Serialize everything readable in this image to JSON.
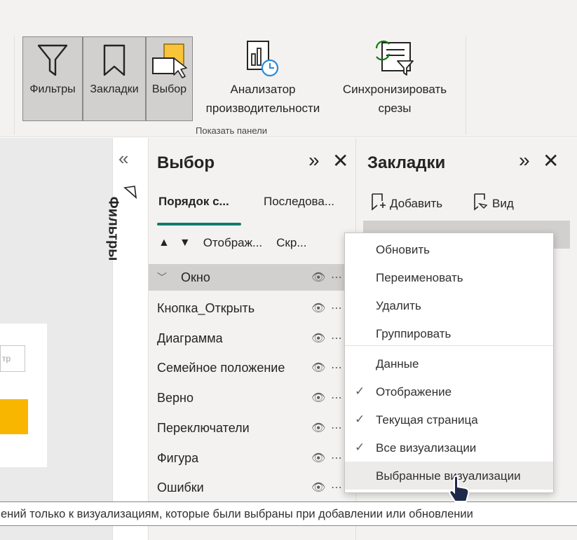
{
  "ribbon": {
    "pane_buttons": [
      {
        "label": "Фильтры",
        "icon": "filter-icon"
      },
      {
        "label": "Закладки",
        "icon": "bookmark-icon"
      },
      {
        "label": "Выбор",
        "icon": "selection-icon"
      }
    ],
    "performance_analyzer": {
      "line1": "Анализатор",
      "line2": "производительности",
      "icon": "performance-analyzer-icon"
    },
    "sync_slicers": {
      "line1": "Синхронизировать",
      "line2": "срезы",
      "icon": "sync-slicers-icon"
    },
    "group_label": "Показать панели"
  },
  "canvas": {
    "input_placeholder": "тр"
  },
  "filters_strip": {
    "label": "Фильтры"
  },
  "selection_pane": {
    "title": "Выбор",
    "tabs": [
      "Порядок с...",
      "Последова..."
    ],
    "order_labels": {
      "show": "Отображ...",
      "hide": "Скр..."
    },
    "layers": [
      {
        "name": "Окно",
        "group": true,
        "selected": true
      },
      {
        "name": "Кнопка_Открыть"
      },
      {
        "name": "Диаграмма"
      },
      {
        "name": "Семейное положение"
      },
      {
        "name": "Верно"
      },
      {
        "name": "Переключатели"
      },
      {
        "name": "Фигура"
      },
      {
        "name": "Ошибки"
      }
    ]
  },
  "bookmarks_pane": {
    "title": "Закладки",
    "add_label": "Добавить",
    "view_label": "Вид"
  },
  "context_menu": {
    "items": [
      {
        "label": "Обновить",
        "checked": false
      },
      {
        "label": "Переименовать",
        "checked": false
      },
      {
        "label": "Удалить",
        "checked": false
      },
      {
        "label": "Группировать",
        "checked": false
      },
      {
        "label": "Данные",
        "checked": false
      },
      {
        "label": "Отображение",
        "checked": true
      },
      {
        "label": "Текущая страница",
        "checked": true
      },
      {
        "label": "Все визуализации",
        "checked": true
      },
      {
        "label": "Выбранные визуализации",
        "checked": false,
        "hovered": true
      }
    ]
  },
  "tooltip": {
    "text": "ений только к визуализациям, которые были выбраны при добавлении или обновлении"
  },
  "colors": {
    "accent": "#107c6c",
    "orange": "#f8b600",
    "pane_bg": "#f3f2f1",
    "selected_bg": "#d2d0ce"
  }
}
